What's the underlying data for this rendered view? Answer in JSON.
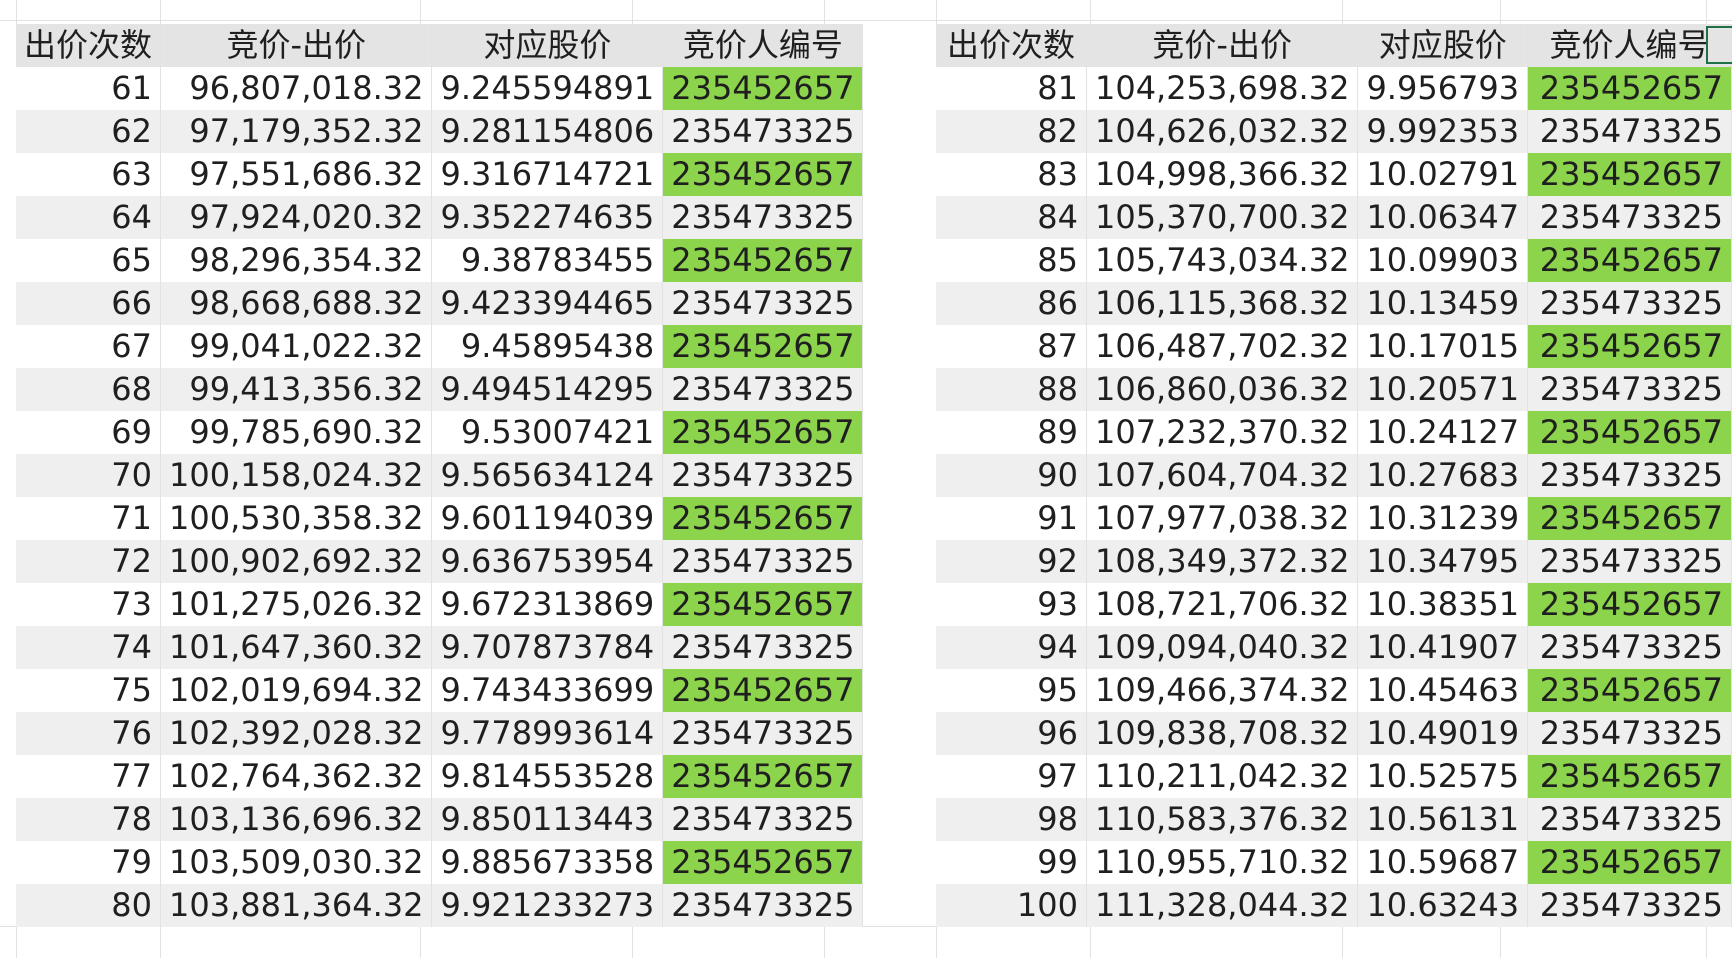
{
  "headers": [
    "出价次数",
    "竞价-出价",
    "对应股价",
    "竞价人编号"
  ],
  "colors": {
    "highlight": "#8cd44b",
    "header_bg": "#e4e4e4",
    "stripe_bg": "#efefef",
    "grid": "#e2e2e2",
    "selection_border": "#1e7145"
  },
  "left_table": {
    "rows": [
      {
        "count": "61",
        "bid": "96,807,018.32",
        "price": "9.245594891",
        "bidder": "235452657",
        "highlight": true
      },
      {
        "count": "62",
        "bid": "97,179,352.32",
        "price": "9.281154806",
        "bidder": "235473325",
        "highlight": false
      },
      {
        "count": "63",
        "bid": "97,551,686.32",
        "price": "9.316714721",
        "bidder": "235452657",
        "highlight": true
      },
      {
        "count": "64",
        "bid": "97,924,020.32",
        "price": "9.352274635",
        "bidder": "235473325",
        "highlight": false
      },
      {
        "count": "65",
        "bid": "98,296,354.32",
        "price": "9.38783455",
        "bidder": "235452657",
        "highlight": true
      },
      {
        "count": "66",
        "bid": "98,668,688.32",
        "price": "9.423394465",
        "bidder": "235473325",
        "highlight": false
      },
      {
        "count": "67",
        "bid": "99,041,022.32",
        "price": "9.45895438",
        "bidder": "235452657",
        "highlight": true
      },
      {
        "count": "68",
        "bid": "99,413,356.32",
        "price": "9.494514295",
        "bidder": "235473325",
        "highlight": false
      },
      {
        "count": "69",
        "bid": "99,785,690.32",
        "price": "9.53007421",
        "bidder": "235452657",
        "highlight": true
      },
      {
        "count": "70",
        "bid": "100,158,024.32",
        "price": "9.565634124",
        "bidder": "235473325",
        "highlight": false
      },
      {
        "count": "71",
        "bid": "100,530,358.32",
        "price": "9.601194039",
        "bidder": "235452657",
        "highlight": true
      },
      {
        "count": "72",
        "bid": "100,902,692.32",
        "price": "9.636753954",
        "bidder": "235473325",
        "highlight": false
      },
      {
        "count": "73",
        "bid": "101,275,026.32",
        "price": "9.672313869",
        "bidder": "235452657",
        "highlight": true
      },
      {
        "count": "74",
        "bid": "101,647,360.32",
        "price": "9.707873784",
        "bidder": "235473325",
        "highlight": false
      },
      {
        "count": "75",
        "bid": "102,019,694.32",
        "price": "9.743433699",
        "bidder": "235452657",
        "highlight": true
      },
      {
        "count": "76",
        "bid": "102,392,028.32",
        "price": "9.778993614",
        "bidder": "235473325",
        "highlight": false
      },
      {
        "count": "77",
        "bid": "102,764,362.32",
        "price": "9.814553528",
        "bidder": "235452657",
        "highlight": true
      },
      {
        "count": "78",
        "bid": "103,136,696.32",
        "price": "9.850113443",
        "bidder": "235473325",
        "highlight": false
      },
      {
        "count": "79",
        "bid": "103,509,030.32",
        "price": "9.885673358",
        "bidder": "235452657",
        "highlight": true
      },
      {
        "count": "80",
        "bid": "103,881,364.32",
        "price": "9.921233273",
        "bidder": "235473325",
        "highlight": false
      }
    ]
  },
  "right_table": {
    "rows": [
      {
        "count": "81",
        "bid": "104,253,698.32",
        "price": "9.956793",
        "bidder": "235452657",
        "highlight": true
      },
      {
        "count": "82",
        "bid": "104,626,032.32",
        "price": "9.992353",
        "bidder": "235473325",
        "highlight": false
      },
      {
        "count": "83",
        "bid": "104,998,366.32",
        "price": "10.02791",
        "bidder": "235452657",
        "highlight": true
      },
      {
        "count": "84",
        "bid": "105,370,700.32",
        "price": "10.06347",
        "bidder": "235473325",
        "highlight": false
      },
      {
        "count": "85",
        "bid": "105,743,034.32",
        "price": "10.09903",
        "bidder": "235452657",
        "highlight": true
      },
      {
        "count": "86",
        "bid": "106,115,368.32",
        "price": "10.13459",
        "bidder": "235473325",
        "highlight": false
      },
      {
        "count": "87",
        "bid": "106,487,702.32",
        "price": "10.17015",
        "bidder": "235452657",
        "highlight": true
      },
      {
        "count": "88",
        "bid": "106,860,036.32",
        "price": "10.20571",
        "bidder": "235473325",
        "highlight": false
      },
      {
        "count": "89",
        "bid": "107,232,370.32",
        "price": "10.24127",
        "bidder": "235452657",
        "highlight": true
      },
      {
        "count": "90",
        "bid": "107,604,704.32",
        "price": "10.27683",
        "bidder": "235473325",
        "highlight": false
      },
      {
        "count": "91",
        "bid": "107,977,038.32",
        "price": "10.31239",
        "bidder": "235452657",
        "highlight": true
      },
      {
        "count": "92",
        "bid": "108,349,372.32",
        "price": "10.34795",
        "bidder": "235473325",
        "highlight": false
      },
      {
        "count": "93",
        "bid": "108,721,706.32",
        "price": "10.38351",
        "bidder": "235452657",
        "highlight": true
      },
      {
        "count": "94",
        "bid": "109,094,040.32",
        "price": "10.41907",
        "bidder": "235473325",
        "highlight": false
      },
      {
        "count": "95",
        "bid": "109,466,374.32",
        "price": "10.45463",
        "bidder": "235452657",
        "highlight": true
      },
      {
        "count": "96",
        "bid": "109,838,708.32",
        "price": "10.49019",
        "bidder": "235473325",
        "highlight": false
      },
      {
        "count": "97",
        "bid": "110,211,042.32",
        "price": "10.52575",
        "bidder": "235452657",
        "highlight": true
      },
      {
        "count": "98",
        "bid": "110,583,376.32",
        "price": "10.56131",
        "bidder": "235473325",
        "highlight": false
      },
      {
        "count": "99",
        "bid": "110,955,710.32",
        "price": "10.59687",
        "bidder": "235452657",
        "highlight": true
      },
      {
        "count": "100",
        "bid": "111,328,044.32",
        "price": "10.63243",
        "bidder": "235473325",
        "highlight": false
      }
    ]
  }
}
